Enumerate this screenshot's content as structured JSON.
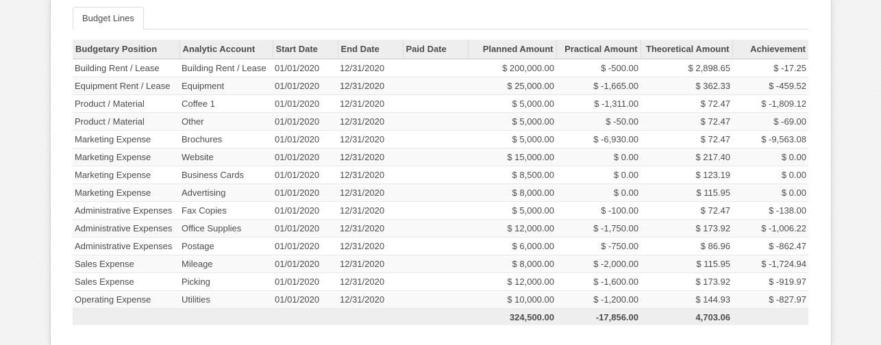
{
  "tabs": [
    {
      "label": "Budget Lines"
    }
  ],
  "columns": [
    "Budgetary Position",
    "Analytic Account",
    "Start Date",
    "End Date",
    "Paid Date",
    "Planned Amount",
    "Practical Amount",
    "Theoretical Amount",
    "Achievement"
  ],
  "rows": [
    [
      "Building Rent / Lease",
      "Building Rent / Lease",
      "01/01/2020",
      "12/31/2020",
      "",
      "$ 200,000.00",
      "$ -500.00",
      "$ 2,898.65",
      "$ -17.25"
    ],
    [
      "Equipment Rent / Lease",
      "Equipment",
      "01/01/2020",
      "12/31/2020",
      "",
      "$ 25,000.00",
      "$ -1,665.00",
      "$ 362.33",
      "$ -459.52"
    ],
    [
      "Product / Material",
      "Coffee 1",
      "01/01/2020",
      "12/31/2020",
      "",
      "$ 5,000.00",
      "$ -1,311.00",
      "$ 72.47",
      "$ -1,809.12"
    ],
    [
      "Product / Material",
      "Other",
      "01/01/2020",
      "12/31/2020",
      "",
      "$ 5,000.00",
      "$ -50.00",
      "$ 72.47",
      "$ -69.00"
    ],
    [
      "Marketing Expense",
      "Brochures",
      "01/01/2020",
      "12/31/2020",
      "",
      "$ 5,000.00",
      "$ -6,930.00",
      "$ 72.47",
      "$ -9,563.08"
    ],
    [
      "Marketing Expense",
      "Website",
      "01/01/2020",
      "12/31/2020",
      "",
      "$ 15,000.00",
      "$ 0.00",
      "$ 217.40",
      "$ 0.00"
    ],
    [
      "Marketing Expense",
      "Business Cards",
      "01/01/2020",
      "12/31/2020",
      "",
      "$ 8,500.00",
      "$ 0.00",
      "$ 123.19",
      "$ 0.00"
    ],
    [
      "Marketing Expense",
      "Advertising",
      "01/01/2020",
      "12/31/2020",
      "",
      "$ 8,000.00",
      "$ 0.00",
      "$ 115.95",
      "$ 0.00"
    ],
    [
      "Administrative Expenses",
      "Fax Copies",
      "01/01/2020",
      "12/31/2020",
      "",
      "$ 5,000.00",
      "$ -100.00",
      "$ 72.47",
      "$ -138.00"
    ],
    [
      "Administrative Expenses",
      "Office Supplies",
      "01/01/2020",
      "12/31/2020",
      "",
      "$ 12,000.00",
      "$ -1,750.00",
      "$ 173.92",
      "$ -1,006.22"
    ],
    [
      "Administrative Expenses",
      "Postage",
      "01/01/2020",
      "12/31/2020",
      "",
      "$ 6,000.00",
      "$ -750.00",
      "$ 86.96",
      "$ -862.47"
    ],
    [
      "Sales Expense",
      "Mileage",
      "01/01/2020",
      "12/31/2020",
      "",
      "$ 8,000.00",
      "$ -2,000.00",
      "$ 115.95",
      "$ -1,724.94"
    ],
    [
      "Sales Expense",
      "Picking",
      "01/01/2020",
      "12/31/2020",
      "",
      "$ 12,000.00",
      "$ -1,600.00",
      "$ 173.92",
      "$ -919.97"
    ],
    [
      "Operating Expense",
      "Utilities",
      "01/01/2020",
      "12/31/2020",
      "",
      "$ 10,000.00",
      "$ -1,200.00",
      "$ 144.93",
      "$ -827.97"
    ]
  ],
  "totals": {
    "planned": "324,500.00",
    "practical": "-17,856.00",
    "theoretical": "4,703.06"
  }
}
